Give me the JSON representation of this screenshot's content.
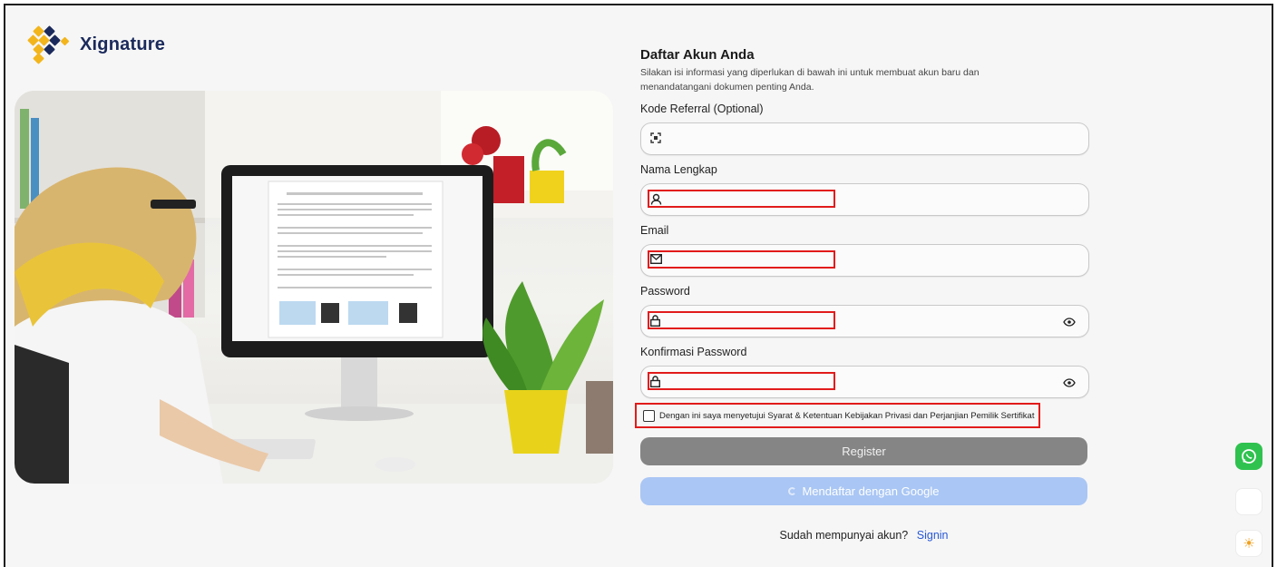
{
  "brand": {
    "name": "Xignature",
    "colors": {
      "navy": "#1b2a5c",
      "gold": "#f3b51c"
    }
  },
  "hero": {
    "image": "woman-at-computer-signing-document"
  },
  "form": {
    "title": "Daftar Akun Anda",
    "subtitle": "Silakan isi informasi yang diperlukan di bawah ini untuk membuat akun baru dan menandatangani dokumen penting Anda.",
    "fields": [
      {
        "label": "Kode Referral (Optional)",
        "icon": "qr-scan-icon",
        "value": "",
        "placeholder": ""
      },
      {
        "label": "Nama Lengkap",
        "icon": "user-icon",
        "value": "",
        "placeholder": ""
      },
      {
        "label": "Email",
        "icon": "mail-icon",
        "value": "",
        "placeholder": ""
      },
      {
        "label": "Password",
        "icon": "lock-icon",
        "value": "",
        "placeholder": ""
      },
      {
        "label": "Konfirmasi Password",
        "icon": "lock-icon",
        "value": "",
        "placeholder": ""
      }
    ],
    "terms_text": "Dengan ini saya menyetujui Syarat & Ketentuan Kebijakan Privasi dan Perjanjian Pemilik Sertifikat",
    "terms_checked": false,
    "register_label": "Register",
    "google_label": "Mendaftar dengan Google",
    "signin_prompt": "Sudah mempunyai akun?",
    "signin_link": "Signin"
  },
  "colors": {
    "highlight": "#e21b1b",
    "register_bg": "#858585",
    "google_bg": "#a9c6f4",
    "link": "#2758d6",
    "whatsapp": "#2fc24f"
  },
  "floating": [
    "whatsapp-icon",
    "blank",
    "sun-icon"
  ]
}
